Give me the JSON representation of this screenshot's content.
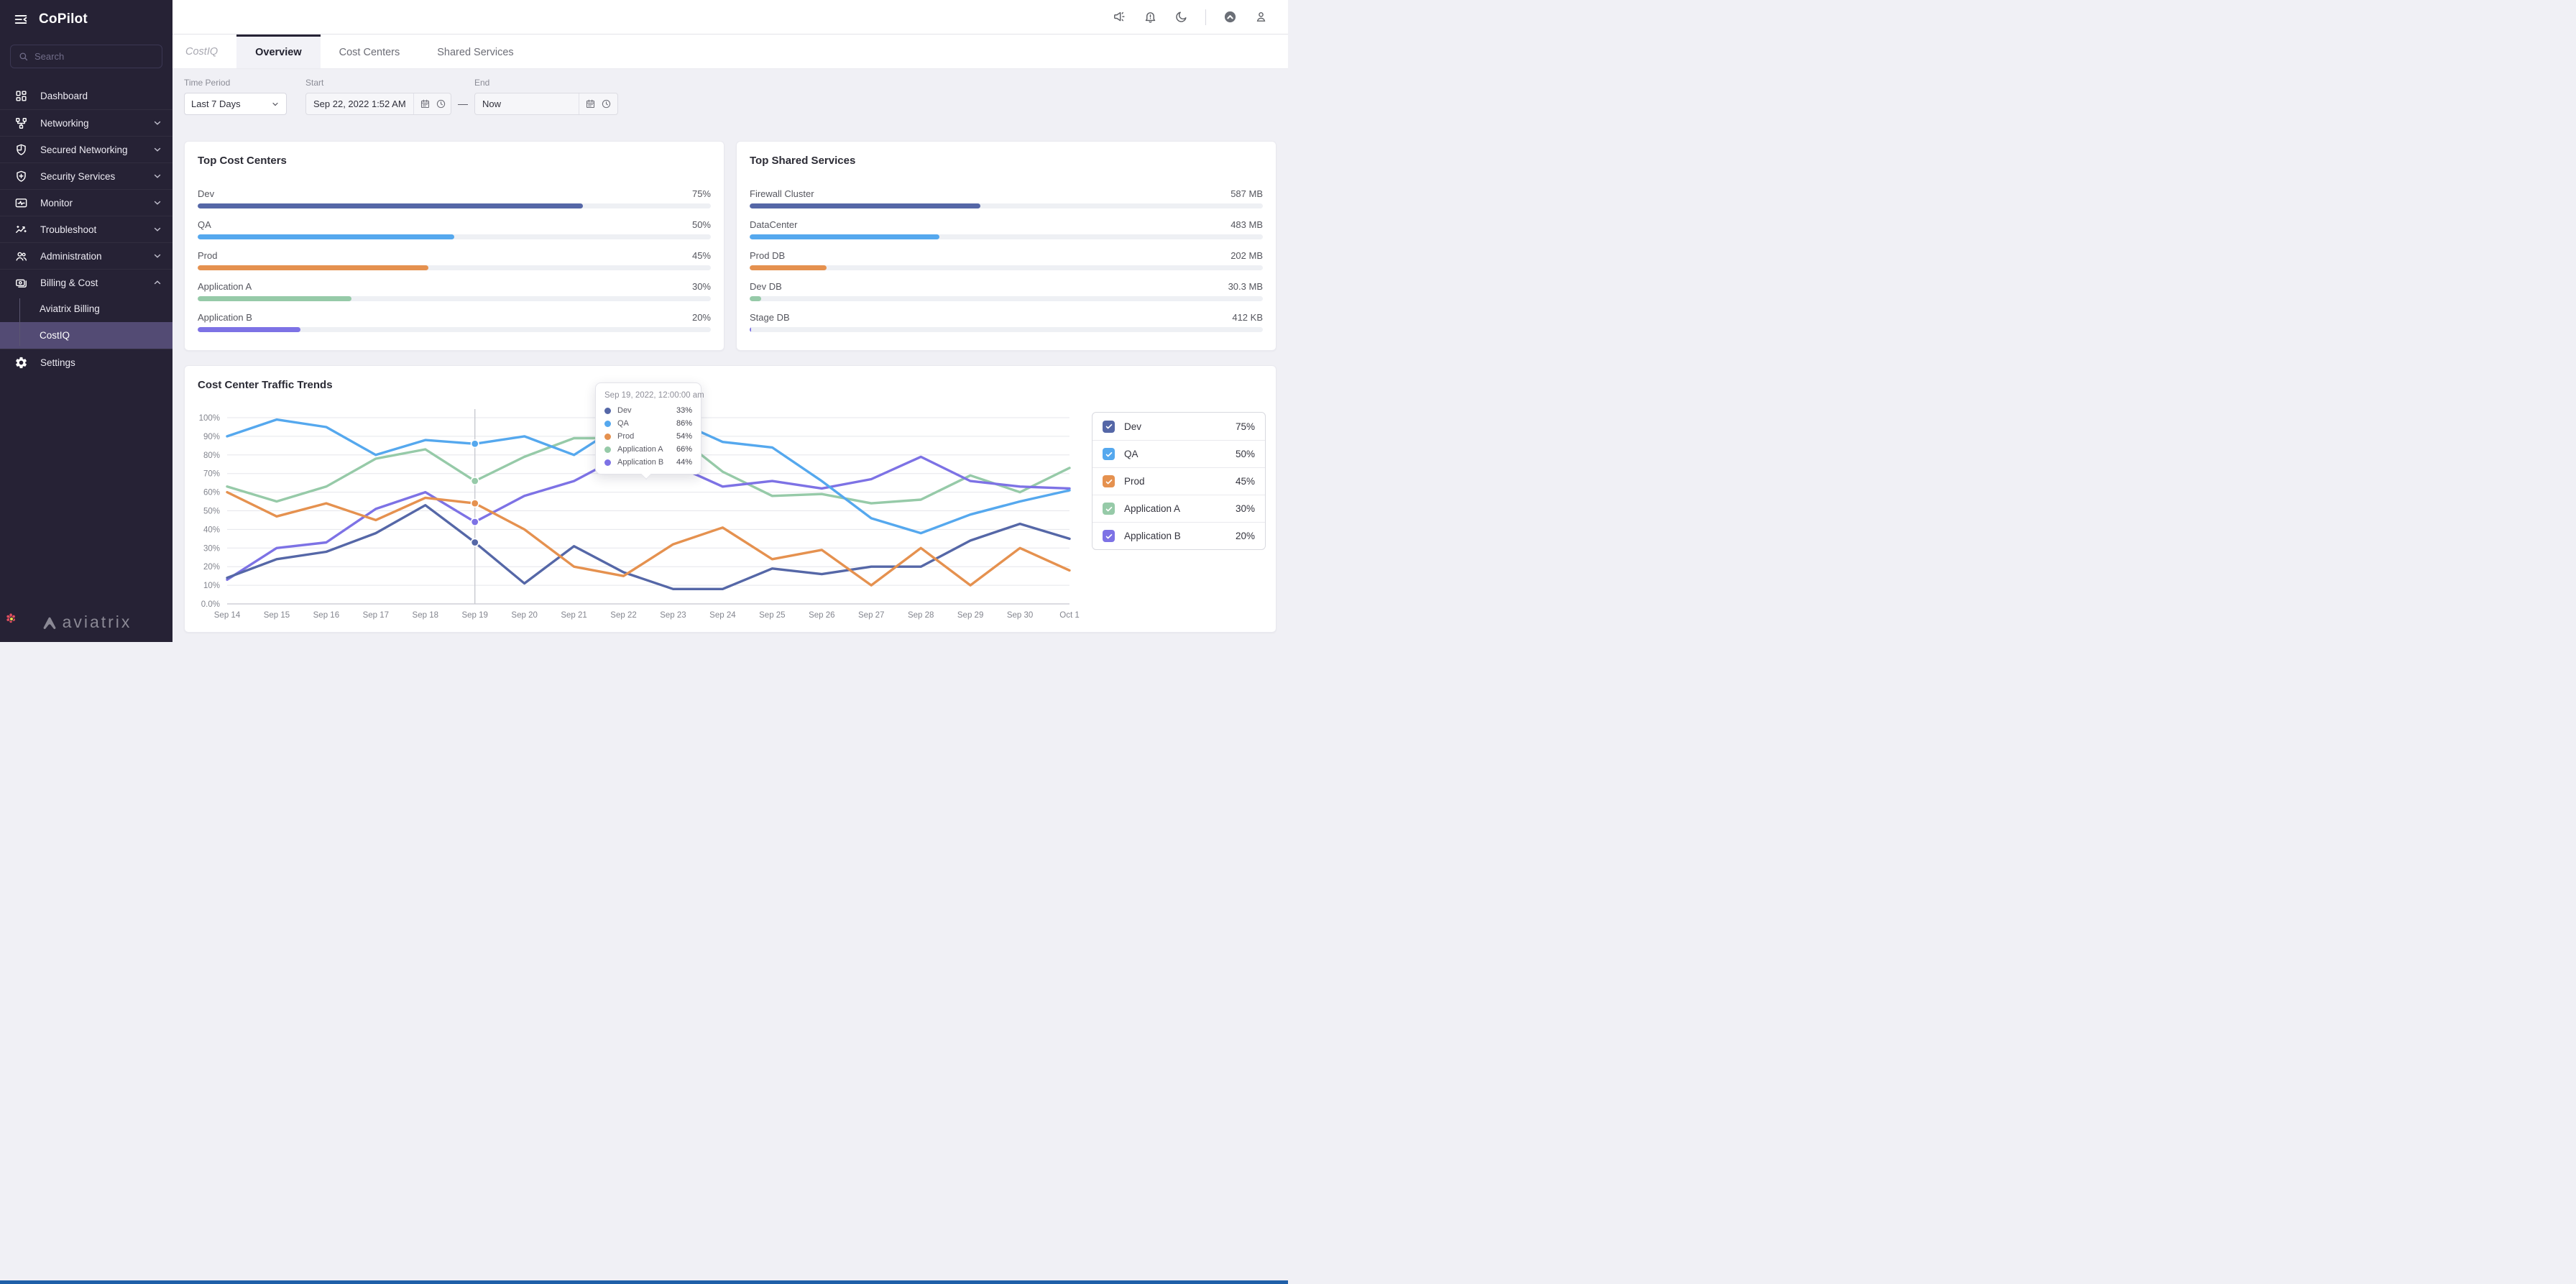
{
  "colors": {
    "dev": "#5567a7",
    "qa": "#55a8ee",
    "prod": "#e5914f",
    "app_a": "#96caa8",
    "app_b": "#7d72e5",
    "sidebar_bg": "#262235",
    "selected_item_bg": "#534b74",
    "status_strip": "#1f5fa8"
  },
  "sidebar": {
    "app_title": "CoPilot",
    "search_placeholder": "Search",
    "items": [
      {
        "label": "Dashboard",
        "icon": "dashboard-icon",
        "expandable": false
      },
      {
        "label": "Networking",
        "icon": "networking-icon",
        "expandable": true
      },
      {
        "label": "Secured Networking",
        "icon": "shield-icon",
        "expandable": true
      },
      {
        "label": "Security Services",
        "icon": "shield-plus-icon",
        "expandable": true
      },
      {
        "label": "Monitor",
        "icon": "monitor-icon",
        "expandable": true
      },
      {
        "label": "Troubleshoot",
        "icon": "troubleshoot-icon",
        "expandable": true
      },
      {
        "label": "Administration",
        "icon": "users-icon",
        "expandable": true
      },
      {
        "label": "Billing & Cost",
        "icon": "billing-icon",
        "expandable": true,
        "expanded": true,
        "children": [
          {
            "label": "Aviatrix Billing",
            "selected": false
          },
          {
            "label": "CostIQ",
            "selected": true
          }
        ]
      },
      {
        "label": "Settings",
        "icon": "gear-icon",
        "expandable": false
      }
    ],
    "logo_text": "aviatrix"
  },
  "topbar": {
    "icons": [
      "megaphone-icon",
      "notifications-bell-icon",
      "dark-mode-moon-icon",
      "aviatrix-logo-icon",
      "user-profile-icon"
    ]
  },
  "tabs": {
    "context_label": "CostIQ",
    "items": [
      {
        "label": "Overview",
        "active": true
      },
      {
        "label": "Cost Centers",
        "active": false
      },
      {
        "label": "Shared Services",
        "active": false
      }
    ]
  },
  "filters": {
    "time_period": {
      "label": "Time Period",
      "value": "Last 7 Days"
    },
    "start": {
      "label": "Start",
      "value": "Sep 22, 2022 1:52 AM"
    },
    "separator": "—",
    "end": {
      "label": "End",
      "value": "Now"
    }
  },
  "cards": {
    "top_cost_centers": {
      "title": "Top Cost Centers",
      "rows": [
        {
          "label": "Dev",
          "value": "75%",
          "pct": 75,
          "color": "#5567a7"
        },
        {
          "label": "QA",
          "value": "50%",
          "pct": 50,
          "color": "#55a8ee"
        },
        {
          "label": "Prod",
          "value": "45%",
          "pct": 45,
          "color": "#e5914f"
        },
        {
          "label": "Application A",
          "value": "30%",
          "pct": 30,
          "color": "#96caa8"
        },
        {
          "label": "Application B",
          "value": "20%",
          "pct": 20,
          "color": "#7d72e5"
        }
      ]
    },
    "top_shared_services": {
      "title": "Top Shared Services",
      "rows": [
        {
          "label": "Firewall Cluster",
          "value": "587 MB",
          "pct": 45,
          "color": "#5567a7"
        },
        {
          "label": "DataCenter",
          "value": "483 MB",
          "pct": 37,
          "color": "#55a8ee"
        },
        {
          "label": "Prod DB",
          "value": "202 MB",
          "pct": 15,
          "color": "#e5914f"
        },
        {
          "label": "Dev DB",
          "value": "30.3 MB",
          "pct": 2.2,
          "color": "#96caa8"
        },
        {
          "label": "Stage DB",
          "value": "412 KB",
          "pct": 0.3,
          "color": "#7d72e5"
        }
      ]
    }
  },
  "tooltip": {
    "title": "Sep 19, 2022, 12:00:00 am",
    "rows": [
      {
        "label": "Dev",
        "value": "33%",
        "color": "#5567a7"
      },
      {
        "label": "QA",
        "value": "86%",
        "color": "#55a8ee"
      },
      {
        "label": "Prod",
        "value": "54%",
        "color": "#e5914f"
      },
      {
        "label": "Application A",
        "value": "66%",
        "color": "#96caa8"
      },
      {
        "label": "Application B",
        "value": "44%",
        "color": "#7d72e5"
      }
    ]
  },
  "trends": {
    "title": "Cost Center Traffic Trends"
  },
  "chart_data": {
    "type": "line",
    "title": "Cost Center Traffic Trends",
    "x": [
      "Sep 14",
      "Sep 15",
      "Sep 16",
      "Sep 17",
      "Sep 18",
      "Sep 19",
      "Sep 20",
      "Sep 21",
      "Sep 22",
      "Sep 23",
      "Sep 24",
      "Sep 25",
      "Sep 26",
      "Sep 27",
      "Sep 28",
      "Sep 29",
      "Sep 30",
      "Oct 1"
    ],
    "y_ticks": [
      "100%",
      "90%",
      "80%",
      "70%",
      "60%",
      "50%",
      "40%",
      "30%",
      "20%",
      "10%",
      "0.0%"
    ],
    "ylim": [
      0,
      100
    ],
    "grid": true,
    "legend_position": "right",
    "hover_index": 5,
    "series": [
      {
        "name": "Dev",
        "color": "#5567a7",
        "legend_value": "75%",
        "values": [
          14,
          24,
          28,
          38,
          53,
          33,
          11,
          31,
          17,
          8,
          8,
          19,
          16,
          20,
          20,
          34,
          43,
          35
        ]
      },
      {
        "name": "QA",
        "color": "#55a8ee",
        "legend_value": "50%",
        "values": [
          90,
          99,
          95,
          80,
          88,
          86,
          90,
          80,
          97,
          99,
          87,
          84,
          66,
          46,
          38,
          48,
          55,
          61
        ]
      },
      {
        "name": "Prod",
        "color": "#e5914f",
        "legend_value": "45%",
        "values": [
          60,
          47,
          54,
          45,
          57,
          54,
          40,
          20,
          15,
          32,
          41,
          24,
          29,
          10,
          30,
          10,
          30,
          18
        ]
      },
      {
        "name": "Application A",
        "color": "#96caa8",
        "legend_value": "30%",
        "values": [
          63,
          55,
          63,
          78,
          83,
          66,
          79,
          89,
          89,
          92,
          71,
          58,
          59,
          54,
          56,
          69,
          60,
          73
        ]
      },
      {
        "name": "Application B",
        "color": "#7d72e5",
        "legend_value": "20%",
        "values": [
          13,
          30,
          33,
          51,
          60,
          44,
          58,
          66,
          80,
          75,
          63,
          66,
          62,
          67,
          79,
          66,
          63,
          62
        ]
      }
    ]
  }
}
